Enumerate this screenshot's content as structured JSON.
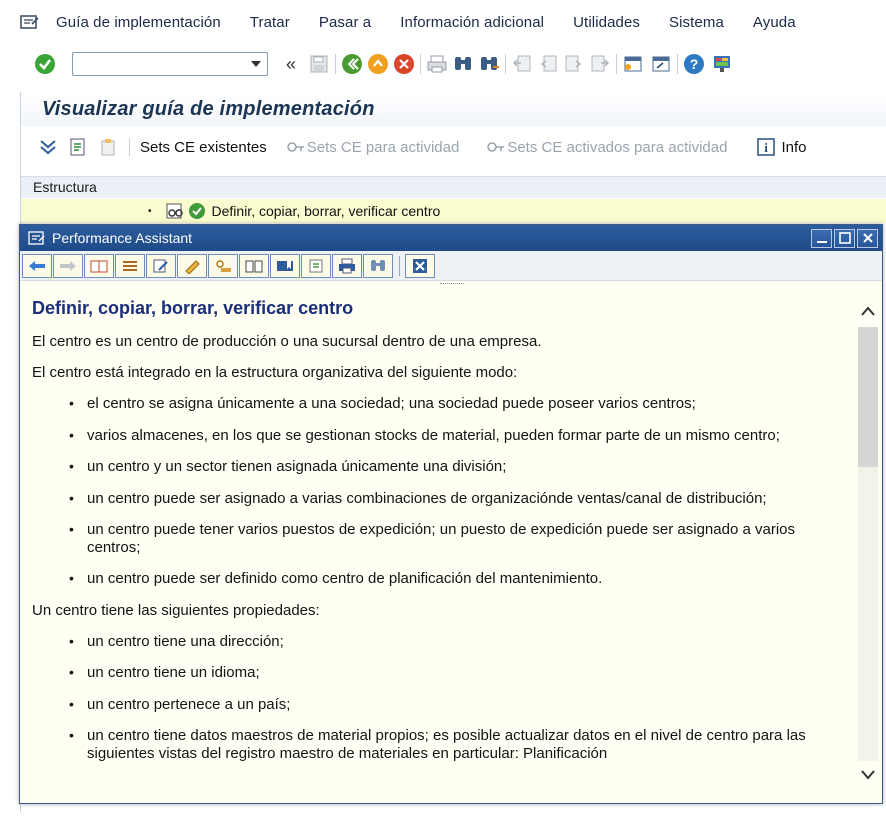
{
  "menubar": {
    "items": [
      "Guía de implementación",
      "Tratar",
      "Pasar a",
      "Información adicional",
      "Utilidades",
      "Sistema",
      "Ayuda"
    ]
  },
  "toolbar": {
    "command_field_value": "",
    "icons": [
      "enter-icon",
      "save-icon",
      "back-icon",
      "exit-icon",
      "cancel-icon",
      "print-icon",
      "find-icon",
      "find-next-icon",
      "first-page-icon",
      "prev-page-icon",
      "next-page-icon",
      "last-page-icon",
      "new-session-icon",
      "shortcut-icon",
      "help-icon",
      "layout-icon"
    ]
  },
  "screen": {
    "title": "Visualizar guía de implementación",
    "app_toolbar": {
      "existing_sets": "Sets CE existentes",
      "sets_for_activity": "Sets CE para actividad",
      "activated_sets": "Sets CE activados para actividad",
      "info": "Info"
    },
    "tree_header": "Estructura",
    "tree_row": "Definir, copiar, borrar, verificar centro"
  },
  "assistant": {
    "title": "Performance Assistant",
    "heading": "Definir, copiar, borrar, verificar centro",
    "p1": "El centro es un centro de producción o una sucursal dentro de una empresa.",
    "p2": "El centro está integrado en la estructura organizativa del siguiente modo:",
    "list1": [
      "el centro se asigna únicamente a una sociedad; una sociedad puede poseer varios centros;",
      "varios almacenes, en los que se gestionan stocks de material, pueden formar parte de un mismo centro;",
      "un centro y un sector tienen asignada únicamente una división;",
      "un centro puede ser asignado a varias combinaciones de organizaciónde ventas/canal de distribución;",
      "un centro puede tener varios puestos de expedición; un puesto de expedición puede ser asignado a varios centros;",
      "un centro puede ser definido como centro de planificación del mantenimiento."
    ],
    "p3": "Un centro tiene las siguientes propiedades:",
    "list2": [
      "un centro tiene una dirección;",
      "un centro tiene un idioma;",
      "un centro pertenece a un país;",
      "un centro tiene datos maestros de material propios; es posible actualizar datos en el nivel de centro para las siguientes vistas del registro maestro de materiales en particular: Planificación"
    ]
  },
  "colors": {
    "highlight_row": "#fbfbd0",
    "assistant_bg": "#fffff4",
    "assistant_titlebar": "#2c5d9e",
    "heading": "#1a2e7a"
  }
}
